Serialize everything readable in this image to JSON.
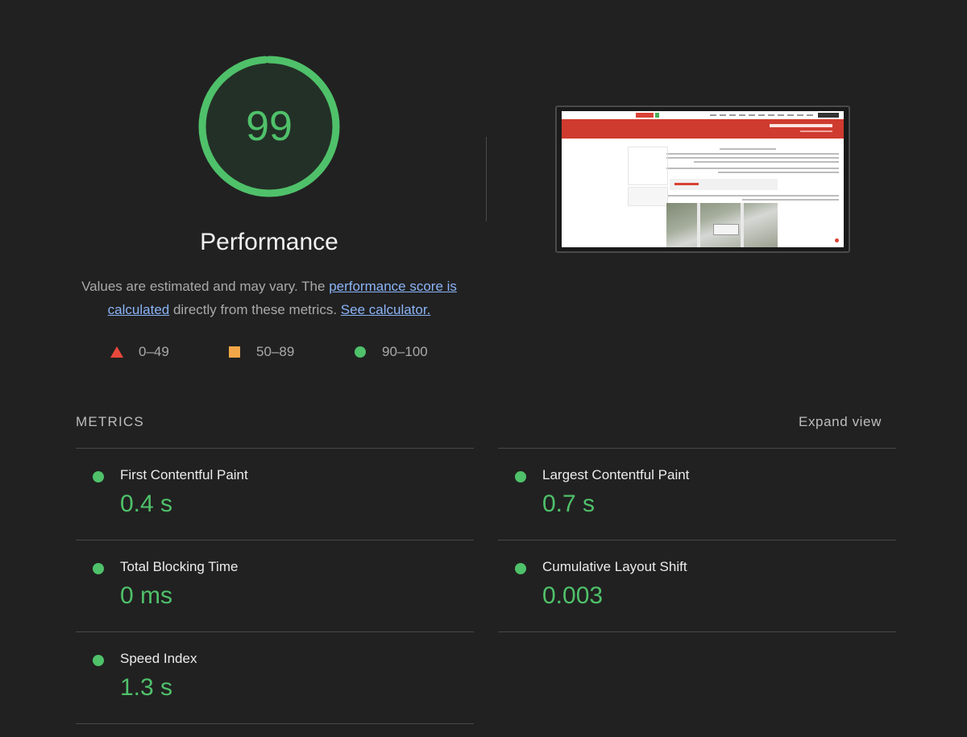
{
  "score": {
    "value": "99",
    "fraction": 0.99,
    "color": "#4fc16a",
    "title": "Performance"
  },
  "description": {
    "text_1": "Values are estimated and may vary. The ",
    "link_1": "performance score is calculated",
    "text_2": " directly from these metrics. ",
    "link_2": "See calculator."
  },
  "legend": {
    "fail": {
      "range": "0–49",
      "color": "#e8483c",
      "icon": "triangle-icon"
    },
    "average": {
      "range": "50–89",
      "color": "#f2a648",
      "icon": "square-icon"
    },
    "pass": {
      "range": "90–100",
      "color": "#4fc16a",
      "icon": "circle-icon"
    }
  },
  "metrics": {
    "header": "METRICS",
    "expand_label": "Expand view",
    "items": [
      {
        "label": "First Contentful Paint",
        "value": "0.4 s"
      },
      {
        "label": "Largest Contentful Paint",
        "value": "0.7 s"
      },
      {
        "label": "Total Blocking Time",
        "value": "0 ms"
      },
      {
        "label": "Cumulative Layout Shift",
        "value": "0.003"
      },
      {
        "label": "Speed Index",
        "value": "1.3 s"
      }
    ]
  },
  "colors": {
    "background": "#212121",
    "pass": "#4fc16a",
    "link": "#8ab4f8"
  }
}
